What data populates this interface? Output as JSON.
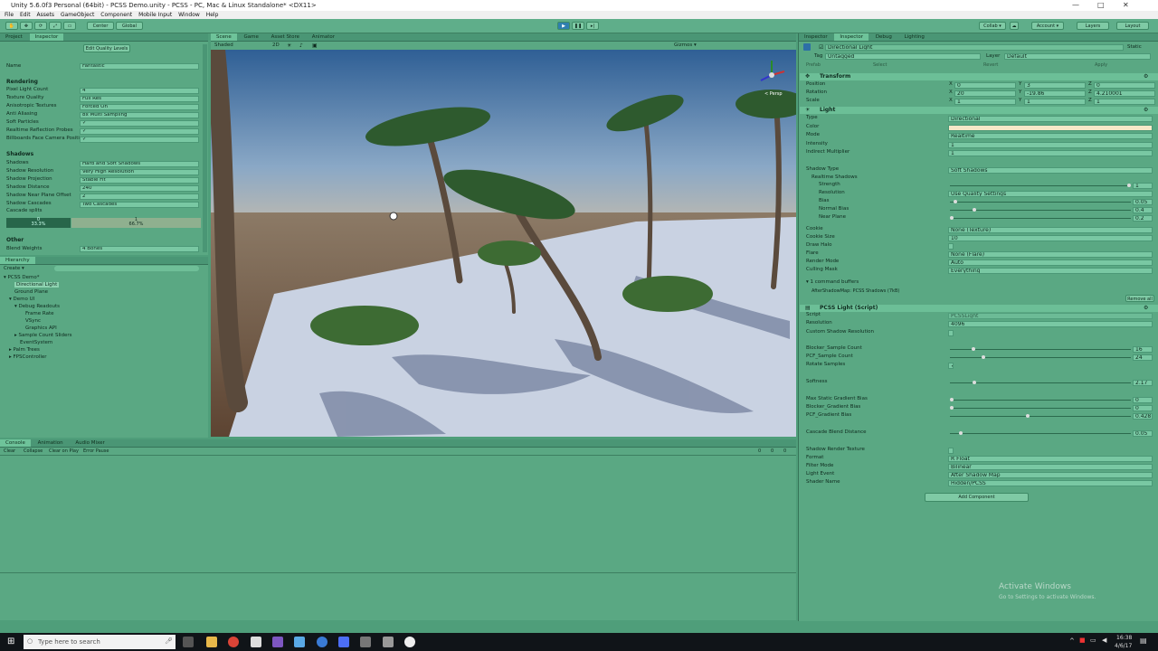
{
  "window": {
    "title": "Unity 5.6.0f3 Personal (64bit) - PCSS Demo.unity - PCSS - PC, Mac & Linux Standalone* <DX11>",
    "controls": [
      "—",
      "□",
      "✕"
    ]
  },
  "menu": [
    "File",
    "Edit",
    "Assets",
    "GameObject",
    "Component",
    "Mobile Input",
    "Window",
    "Help"
  ],
  "toolbar": {
    "center_label": "Center",
    "global_label": "Global",
    "collab": "Collab ▾",
    "account": "Account ▾",
    "layers": "Layers",
    "layout": "Layout"
  },
  "left_panel": {
    "tabs": [
      "Project",
      "Inspector"
    ],
    "edit_quality": "Edit Quality Levels",
    "name_label": "Name",
    "name_value": "Fantastic",
    "rendering_header": "Rendering",
    "rendering": [
      {
        "label": "Pixel Light Count",
        "value": "4"
      },
      {
        "label": "Texture Quality",
        "value": "Full Res"
      },
      {
        "label": "Anisotropic Textures",
        "value": "Forced On"
      },
      {
        "label": "Anti Aliasing",
        "value": "8x Multi Sampling"
      },
      {
        "label": "Soft Particles",
        "value": "✓"
      },
      {
        "label": "Realtime Reflection Probes",
        "value": "✓"
      },
      {
        "label": "Billboards Face Camera Position",
        "value": "✓"
      }
    ],
    "shadows_header": "Shadows",
    "shadows": [
      {
        "label": "Shadows",
        "value": "Hard and Soft Shadows"
      },
      {
        "label": "Shadow Resolution",
        "value": "Very High Resolution"
      },
      {
        "label": "Shadow Projection",
        "value": "Stable Fit"
      },
      {
        "label": "Shadow Distance",
        "value": "240"
      },
      {
        "label": "Shadow Near Plane Offset",
        "value": "2"
      },
      {
        "label": "Shadow Cascades",
        "value": "Two Cascades"
      }
    ],
    "cascade_label": "Cascade splits",
    "cascade_a": "0\n33.3%",
    "cascade_b": "1\n66.7%",
    "other_header": "Other",
    "blend_label": "Blend Weights",
    "blend_value": "4 Bones"
  },
  "hierarchy": {
    "tab": "Hierarchy",
    "create": "Create ▾",
    "items": [
      {
        "text": "▾ PCSS Demo*",
        "indent": 0
      },
      {
        "text": "Directional Light",
        "indent": 2
      },
      {
        "text": "Ground Plane",
        "indent": 2
      },
      {
        "text": "▾ Demo UI",
        "indent": 1
      },
      {
        "text": "▾ Debug Readouts",
        "indent": 2
      },
      {
        "text": "Frame Rate",
        "indent": 4
      },
      {
        "text": "VSync",
        "indent": 4
      },
      {
        "text": "Graphics API",
        "indent": 4
      },
      {
        "text": "▸ Sample Count Sliders",
        "indent": 2
      },
      {
        "text": "EventSystem",
        "indent": 3
      },
      {
        "text": "▸ Palm Trees",
        "indent": 1
      },
      {
        "text": "▸ FPSController",
        "indent": 1
      }
    ]
  },
  "scene": {
    "tabs": [
      "Scene",
      "Game",
      "Asset Store",
      "Animator"
    ],
    "shading": "Shaded",
    "mode2d": "2D",
    "gizmos": "Gizmos ▾",
    "persp": "< Persp"
  },
  "console": {
    "tabs": [
      "Console",
      "Animation",
      "Audio Mixer"
    ],
    "buttons": [
      "Clear",
      "Collapse",
      "Clear on Play",
      "Error Pause"
    ],
    "counts": [
      "0",
      "0",
      "0"
    ]
  },
  "inspector": {
    "tabs": [
      "Inspector",
      "Inspector",
      "Debug",
      "Lighting"
    ],
    "object_name": "Directional Light",
    "static": "Static",
    "tag_label": "Tag",
    "tag_value": "Untagged",
    "layer_label": "Layer",
    "layer_value": "Default",
    "prefab_label": "Prefab",
    "prefab_buttons": [
      "Select",
      "Revert",
      "Apply"
    ],
    "transform_header": "Transform",
    "transform": [
      {
        "label": "Position",
        "x": "0",
        "y": "3",
        "z": "0"
      },
      {
        "label": "Rotation",
        "x": "20",
        "y": "-19.86",
        "z": "4.210001"
      },
      {
        "label": "Scale",
        "x": "1",
        "y": "1",
        "z": "1"
      }
    ],
    "light_header": "Light",
    "light": [
      {
        "label": "Type",
        "value": "Directional"
      },
      {
        "label": "Color",
        "value": ""
      },
      {
        "label": "Mode",
        "value": "Realtime"
      },
      {
        "label": "Intensity",
        "value": "1"
      },
      {
        "label": "Indirect Multiplier",
        "value": "1"
      },
      {
        "label": "Shadow Type",
        "value": "Soft Shadows"
      }
    ],
    "realtime_shadows": "Realtime Shadows",
    "shadow_sliders": [
      {
        "label": "Strength",
        "value": "1",
        "fill": 1.0
      },
      {
        "label": "Resolution",
        "value": "Use Quality Settings",
        "fill": -1
      },
      {
        "label": "Bias",
        "value": "0.05",
        "fill": 0.02
      },
      {
        "label": "Normal Bias",
        "value": "0.4",
        "fill": 0.13
      },
      {
        "label": "Near Plane",
        "value": "0.2",
        "fill": 0.0
      }
    ],
    "light2": [
      {
        "label": "Cookie",
        "value": "None (Texture)"
      },
      {
        "label": "Cookie Size",
        "value": "10"
      },
      {
        "label": "Draw Halo",
        "value": ""
      },
      {
        "label": "Flare",
        "value": "None (Flare)"
      },
      {
        "label": "Render Mode",
        "value": "Auto"
      },
      {
        "label": "Culling Mask",
        "value": "Everything"
      }
    ],
    "command_buffers": "▾ 1 command buffers",
    "command_buffer_item": "AfterShadowMap: PCSS Shadows (7kB)",
    "remove_all": "Remove all",
    "pcss_header": "PCSS Light (Script)",
    "pcss_script_label": "Script",
    "pcss_script_value": "PCSSLight",
    "pcss_resolution_label": "Resolution",
    "pcss_resolution_value": "4096",
    "custom_res_label": "Custom Shadow Resolution",
    "pcss_sliders": [
      {
        "label": "Blocker_Sample Count",
        "value": "16",
        "fill": 0.12
      },
      {
        "label": "PCF_Sample Count",
        "value": "24",
        "fill": 0.18
      }
    ],
    "rotate_label": "Rotate Samples",
    "softness": {
      "label": "Softness",
      "value": "2.17",
      "fill": 0.13
    },
    "pcss_sliders2": [
      {
        "label": "Max Static Gradient Bias",
        "value": "0",
        "fill": 0.0
      },
      {
        "label": "Blocker_Gradient Bias",
        "value": "0",
        "fill": 0.0
      },
      {
        "label": "PCF_Gradient Bias",
        "value": "0.428",
        "fill": 0.43
      }
    ],
    "cascade_blend": {
      "label": "Cascade Blend Distance",
      "value": "0.05",
      "fill": 0.05
    },
    "shadow_rt_label": "Shadow Render Texture",
    "pcss_props": [
      {
        "label": "Format",
        "value": "R Float"
      },
      {
        "label": "Filter Mode",
        "value": "Bilinear"
      },
      {
        "label": "Light Event",
        "value": "After Shadow Map"
      },
      {
        "label": "Shader Name",
        "value": "Hidden/PCSS"
      }
    ],
    "add_component": "Add Component"
  },
  "activate": {
    "title": "Activate Windows",
    "sub": "Go to Settings to activate Windows."
  },
  "taskbar": {
    "search": "Type here to search",
    "time": "16:38",
    "date": "4/6/17"
  }
}
